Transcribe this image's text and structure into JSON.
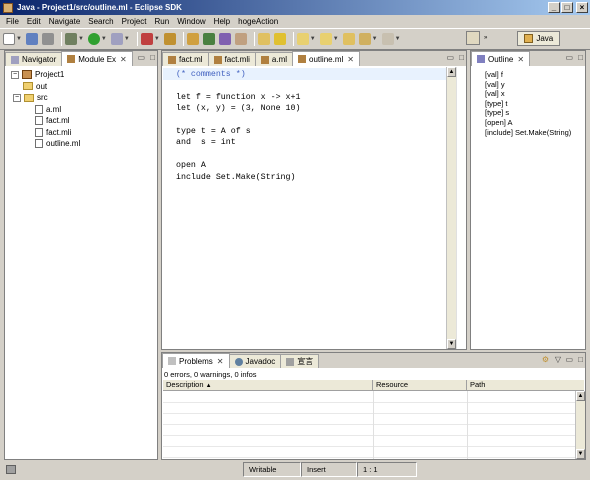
{
  "window": {
    "title": "Java - Project1/src/outline.ml - Eclipse SDK"
  },
  "menu": [
    "File",
    "Edit",
    "Navigate",
    "Search",
    "Project",
    "Run",
    "Window",
    "Help",
    "hogeAction"
  ],
  "perspective": {
    "label": "Java"
  },
  "left_pane": {
    "tabs": [
      "Navigator",
      "Module Ex"
    ],
    "tree": {
      "project": "Project1",
      "folders": [
        "out",
        "src"
      ],
      "files": [
        "a.ml",
        "fact.ml",
        "fact.mli",
        "outline.ml"
      ]
    }
  },
  "editor": {
    "tabs": [
      "fact.ml",
      "fact.mli",
      "a.ml",
      "outline.ml"
    ],
    "lines": [
      "(* comments *)",
      "",
      "let f = function x -> x+1",
      "let (x, y) = (3, None 10)",
      "",
      "type t = A of s",
      "and  s = int",
      "",
      "open A",
      "include Set.Make(String)"
    ]
  },
  "outline": {
    "tab": "Outline",
    "items": [
      "[val] f",
      "[val] y",
      "[val] x",
      "[type] t",
      "[type] s",
      "[open] A",
      "[include] Set.Make(String)"
    ]
  },
  "bottom_pane": {
    "tabs": [
      "Problems",
      "Javadoc",
      "宣言"
    ],
    "summary": "0 errors, 0 warnings, 0 infos",
    "columns": [
      "Description",
      "Resource",
      "Path"
    ]
  },
  "status": {
    "mode": "Writable",
    "insert": "Insert",
    "position": "1 : 1"
  }
}
